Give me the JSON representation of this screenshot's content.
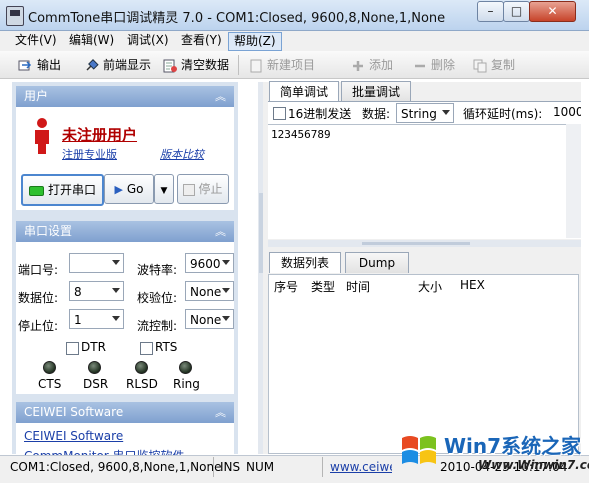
{
  "window": {
    "title": "CommTone串口调试精灵 7.0 - COM1:Closed, 9600,8,None,1,None",
    "minimize": "–",
    "maximize": "□",
    "close": "✕"
  },
  "menu": [
    "文件(V)",
    "编辑(W)",
    "调试(X)",
    "查看(Y)",
    "帮助(Z)"
  ],
  "toolbar": {
    "output": "输出",
    "foreground": "前端显示",
    "clear": "清空数据",
    "new_item": "新建项目",
    "add": "添加",
    "delete": "删除",
    "copy": "复制"
  },
  "user_section": {
    "header": "用户",
    "user_name": "未注册用户",
    "register_link": "注册专业版",
    "compare_link": "版本比较",
    "open_port": "打开串口",
    "go": "Go",
    "stop": "停止"
  },
  "port_section": {
    "header": "串口设置",
    "port_label": "端口号:",
    "port_value": "",
    "baud_label": "波特率:",
    "baud_value": "9600",
    "databits_label": "数据位:",
    "databits_value": "8",
    "parity_label": "校验位:",
    "parity_value": "None",
    "stopbits_label": "停止位:",
    "stopbits_value": "1",
    "flow_label": "流控制:",
    "flow_value": "None",
    "dtr": "DTR",
    "rts": "RTS",
    "leds": [
      "CTS",
      "DSR",
      "RLSD",
      "Ring"
    ]
  },
  "ceiwei_section": {
    "header": "CEIWEI Software",
    "link1": "CEIWEI Software",
    "link2": "CommMonitor 串口监控软件"
  },
  "tabs_top": [
    "简单调试",
    "批量调试"
  ],
  "simple_debug": {
    "hex_send": "16进制发送",
    "data_label": "数据:",
    "data_type": "String",
    "loop_label": "循环延时(ms):",
    "loop_value": "1000",
    "editor_text": "123456789"
  },
  "tabs_bottom": [
    "数据列表",
    "Dump"
  ],
  "list_columns": [
    "序号",
    "类型",
    "时间",
    "大小",
    "HEX"
  ],
  "status": {
    "port": "COM1:Closed, 9600,8,None,1,None",
    "ins": "INS",
    "num": "NUM",
    "url": "www.ceiwei.com",
    "time": "2010-04-23 10:17:04"
  },
  "watermark": {
    "brand": "Win7系统之家",
    "url": "Www.Winwin7.com"
  },
  "colors": {
    "title_bg": "#c8dbf1",
    "section_header": "#8eaad6",
    "user_red": "#b00000",
    "link_blue": "#1b3fa8"
  }
}
